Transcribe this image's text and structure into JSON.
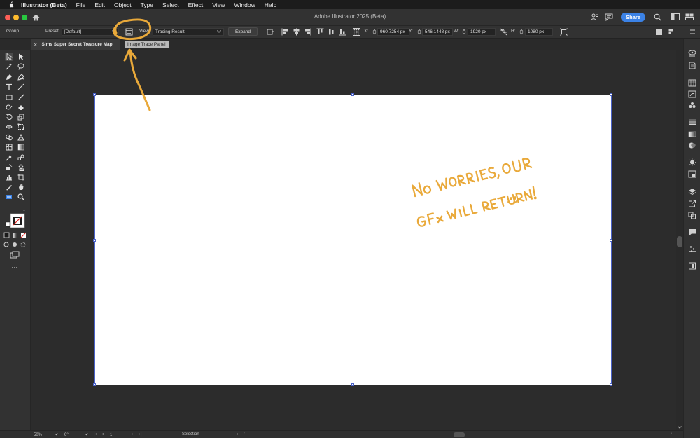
{
  "menubar": {
    "items": [
      "Illustrator (Beta)",
      "File",
      "Edit",
      "Object",
      "Type",
      "Select",
      "Effect",
      "View",
      "Window",
      "Help"
    ]
  },
  "titlebar": {
    "title": "Adobe Illustrator 2025 (Beta)",
    "share_label": "Share"
  },
  "controlbar": {
    "selection_type": "Group",
    "preset_label": "Preset:",
    "preset_value": "[Default]",
    "view_label": "View:",
    "view_value": "Tracing Result",
    "expand_label": "Expand",
    "x_label": "X:",
    "x_value": "960.7254 px",
    "y_label": "Y:",
    "y_value": "546.1448 px",
    "w_label": "W:",
    "w_value": "1920 px",
    "h_label": "H:",
    "h_value": "1080 px"
  },
  "document": {
    "tab_title": "Sims Super Secret Treasure Map",
    "tooltip": "Image Trace Panel"
  },
  "annotation": {
    "line1": "No worries, our",
    "line2": "GFx will return!",
    "smiley": "ü",
    "color": "#e9a93a"
  },
  "statusbar": {
    "zoom": "50%",
    "rotation": "0°",
    "artboard_number": "1",
    "tool_name": "Selection"
  },
  "colors": {
    "accent": "#3b82e6",
    "selection": "#4a62c9",
    "annotation": "#e9a93a"
  }
}
